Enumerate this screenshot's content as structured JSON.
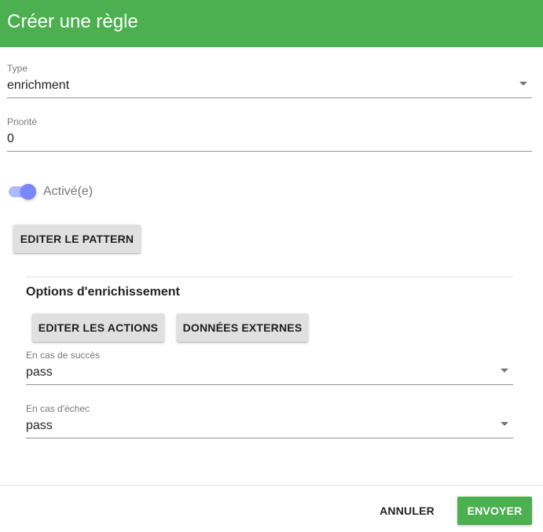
{
  "dialog": {
    "title": "Créer une règle"
  },
  "form": {
    "type": {
      "label": "Type",
      "value": "enrichment"
    },
    "priority": {
      "label": "Priorité",
      "value": "0"
    },
    "enabled": {
      "label": "Activé(e)",
      "checked": true
    },
    "edit_pattern_label": "EDITER LE PATTERN"
  },
  "enrichment": {
    "section_title": "Options d'enrichissement",
    "edit_actions_label": "EDITER LES ACTIONS",
    "external_data_label": "DONNÉES EXTERNES",
    "on_success": {
      "label": "En cas de succès",
      "value": "pass"
    },
    "on_failure": {
      "label": "En cas d'échec",
      "value": "pass"
    }
  },
  "footer": {
    "cancel_label": "ANNULER",
    "submit_label": "ENVOYER"
  },
  "colors": {
    "header": "#4caf50",
    "switch_accent": "#7986fe",
    "primary_button": "#4caf50"
  },
  "icons": {
    "dropdown": "dropdown-arrow-icon"
  }
}
